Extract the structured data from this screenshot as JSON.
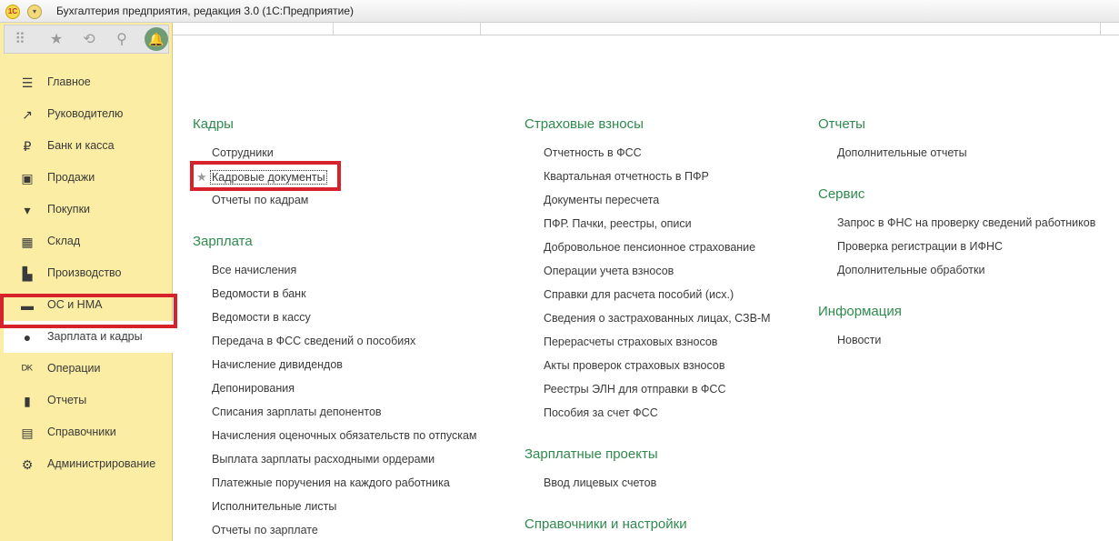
{
  "window": {
    "title": "Бухгалтерия предприятия, редакция 3.0  (1С:Предприятие)",
    "logo_text": "1С"
  },
  "colors": {
    "sidebar_bg": "#fbeda3",
    "section_title": "#2f8a4e",
    "highlight": "#d8222b"
  },
  "sidebar": {
    "items": [
      {
        "label": "Главное",
        "icon": "menu-lines-icon"
      },
      {
        "label": "Руководителю",
        "icon": "trend-up-icon"
      },
      {
        "label": "Банк и касса",
        "icon": "ruble-icon"
      },
      {
        "label": "Продажи",
        "icon": "shopping-bag-icon"
      },
      {
        "label": "Покупки",
        "icon": "cart-icon"
      },
      {
        "label": "Склад",
        "icon": "warehouse-grid-icon"
      },
      {
        "label": "Производство",
        "icon": "factory-icon"
      },
      {
        "label": "ОС и НМА",
        "icon": "truck-icon"
      },
      {
        "label": "Зарплата и кадры",
        "icon": "person-icon"
      },
      {
        "label": "Операции",
        "icon": "dt-kt-icon"
      },
      {
        "label": "Отчеты",
        "icon": "bar-chart-icon"
      },
      {
        "label": "Справочники",
        "icon": "books-icon"
      },
      {
        "label": "Администрирование",
        "icon": "gear-icon"
      }
    ],
    "active_index": 8
  },
  "columns": {
    "left": {
      "sections": [
        {
          "title": "Кадры",
          "links": [
            "Сотрудники",
            "Кадровые документы",
            "Отчеты по кадрам"
          ]
        },
        {
          "title": "Зарплата",
          "links": [
            "Все начисления",
            "Ведомости в банк",
            "Ведомости в кассу",
            "Передача в ФСС сведений о пособиях",
            "Начисление дивидендов",
            "Депонирования",
            "Списания зарплаты депонентов",
            "Начисления оценочных обязательств по отпускам",
            "Выплата зарплаты расходными ордерами",
            "Платежные поручения на каждого работника",
            "Исполнительные листы",
            "Отчеты по зарплате"
          ]
        }
      ]
    },
    "middle": {
      "sections": [
        {
          "title": "Страховые взносы",
          "links": [
            "Отчетность в ФСС",
            "Квартальная отчетность в ПФР",
            "Документы пересчета",
            "ПФР. Пачки, реестры, описи",
            "Добровольное пенсионное страхование",
            "Операции учета взносов",
            "Справки для расчета пособий (исх.)",
            "Сведения о застрахованных лицах, СЗВ-М",
            "Перерасчеты страховых взносов",
            "Акты проверок страховых взносов",
            "Реестры ЭЛН для отправки в ФСС",
            "Пособия за счет ФСС"
          ]
        },
        {
          "title": "Зарплатные проекты",
          "links": [
            "Ввод лицевых счетов"
          ]
        },
        {
          "title": "Справочники и настройки",
          "links": []
        }
      ]
    },
    "right": {
      "sections": [
        {
          "title": "Отчеты",
          "links": [
            "Дополнительные отчеты"
          ]
        },
        {
          "title": "Сервис",
          "links": [
            "Запрос в ФНС на проверку сведений работников",
            "Проверка регистрации в ИФНС",
            "Дополнительные обработки"
          ]
        },
        {
          "title": "Информация",
          "links": [
            "Новости"
          ]
        }
      ]
    }
  }
}
